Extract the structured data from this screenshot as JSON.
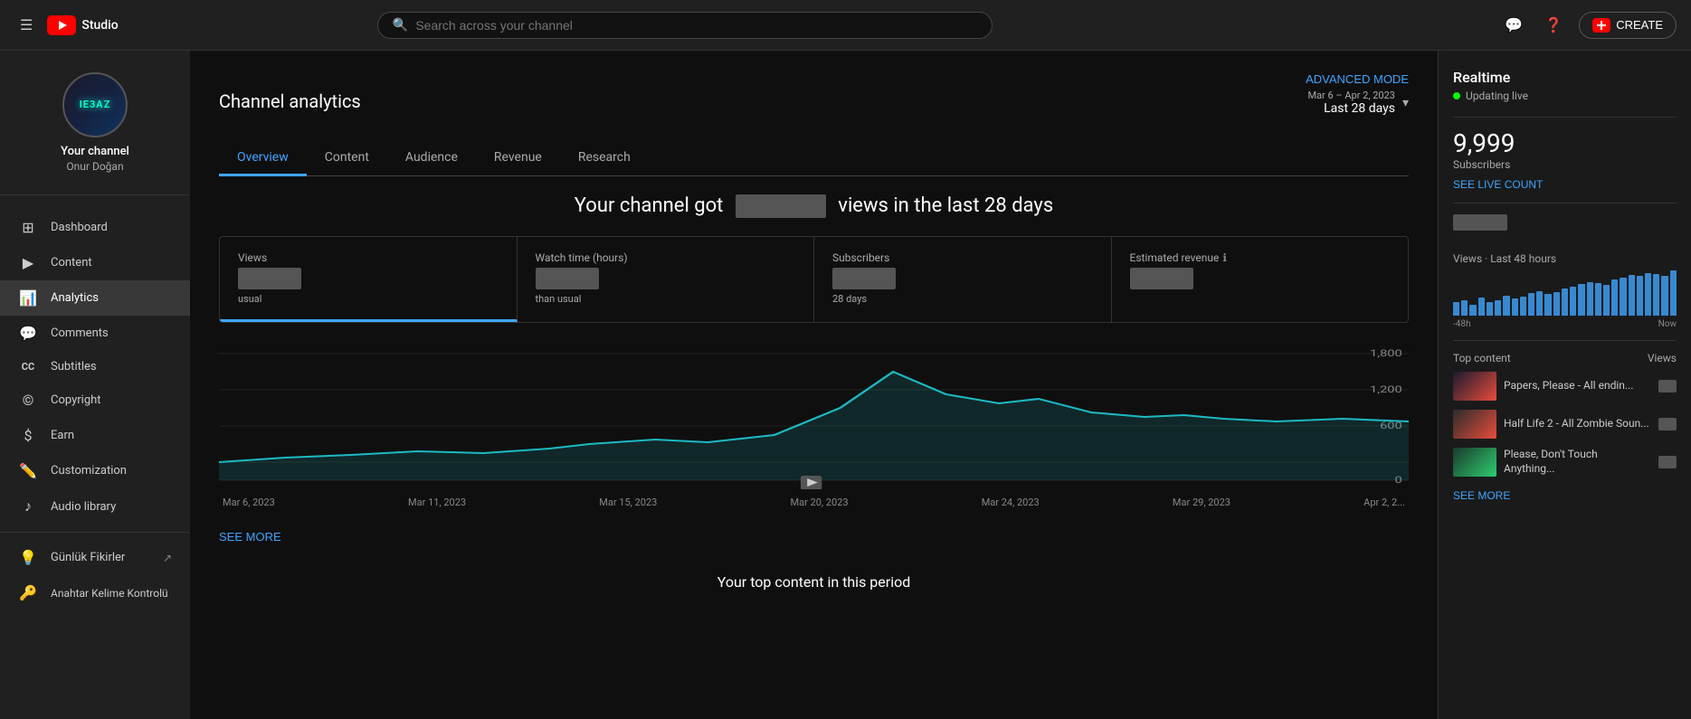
{
  "topbar": {
    "search_placeholder": "Search across your channel",
    "create_label": "CREATE"
  },
  "sidebar": {
    "channel_name": "Your channel",
    "channel_username": "Onur Doğan",
    "avatar_text": "IE3AZ",
    "nav_items": [
      {
        "id": "dashboard",
        "label": "Dashboard",
        "icon": "⊞"
      },
      {
        "id": "content",
        "label": "Content",
        "icon": "▶"
      },
      {
        "id": "analytics",
        "label": "Analytics",
        "icon": "📊",
        "active": true
      },
      {
        "id": "comments",
        "label": "Comments",
        "icon": "💬"
      },
      {
        "id": "subtitles",
        "label": "Subtitles",
        "icon": "CC"
      },
      {
        "id": "copyright",
        "label": "Copyright",
        "icon": "©"
      },
      {
        "id": "earn",
        "label": "Earn",
        "icon": "$"
      },
      {
        "id": "customization",
        "label": "Customization",
        "icon": "✏️"
      },
      {
        "id": "audio_library",
        "label": "Audio library",
        "icon": "♪"
      },
      {
        "id": "gunluk",
        "label": "Günlük Fikirler",
        "icon": "💡",
        "ext": "↗"
      },
      {
        "id": "anahtar",
        "label": "Anahtar Kelime Kontrolü",
        "icon": "🔑"
      }
    ]
  },
  "main": {
    "page_title": "Channel analytics",
    "advanced_mode": "ADVANCED MODE",
    "date_range_small": "Mar 6 – Apr 2, 2023",
    "date_range_main": "Last 28 days",
    "tabs": [
      {
        "id": "overview",
        "label": "Overview",
        "active": true
      },
      {
        "id": "content",
        "label": "Content",
        "active": false
      },
      {
        "id": "audience",
        "label": "Audience",
        "active": false
      },
      {
        "id": "revenue",
        "label": "Revenue",
        "active": false
      },
      {
        "id": "research",
        "label": "Research",
        "active": false
      }
    ],
    "summary_text_pre": "Your channel got",
    "summary_text_post": "views in the last 28 days",
    "metrics": [
      {
        "id": "views",
        "label": "Views",
        "sub_label": "usual",
        "active": true
      },
      {
        "id": "watch_time",
        "label": "Watch time (hours)",
        "sub_label": "than usual"
      },
      {
        "id": "subscribers",
        "label": "Subscribers",
        "sub_label": "28 days"
      },
      {
        "id": "est_revenue",
        "label": "Estimated revenue",
        "sub_label": ""
      }
    ],
    "chart_xaxis": [
      "Mar 6, 2023",
      "Mar 11, 2023",
      "Mar 15, 2023",
      "Mar 20, 2023",
      "Mar 24, 2023",
      "Mar 29, 2023",
      "Apr 2, 2..."
    ],
    "chart_yaxis": [
      "1,800",
      "1,200",
      "600",
      "0"
    ],
    "see_more_label": "SEE MORE",
    "bottom_title": "Your top content in this period"
  },
  "realtime": {
    "title": "Realtime",
    "live_label": "Updating live",
    "subscribers_count": "9,999",
    "subscribers_label": "Subscribers",
    "see_live_label": "SEE LIVE COUNT",
    "views_label": "Views · Last 48 hours",
    "chart_xaxis_left": "-48h",
    "chart_xaxis_right": "Now",
    "top_content_label": "Top content",
    "top_content_views_label": "Views",
    "top_content_items": [
      {
        "title": "Papers, Please - All endin...",
        "thumb_class": "thumb-1"
      },
      {
        "title": "Half Life 2 - All Zombie Soun...",
        "thumb_class": "thumb-2"
      },
      {
        "title": "Please, Don't Touch Anything...",
        "thumb_class": "thumb-3"
      }
    ],
    "see_more_label": "SEE MORE"
  }
}
